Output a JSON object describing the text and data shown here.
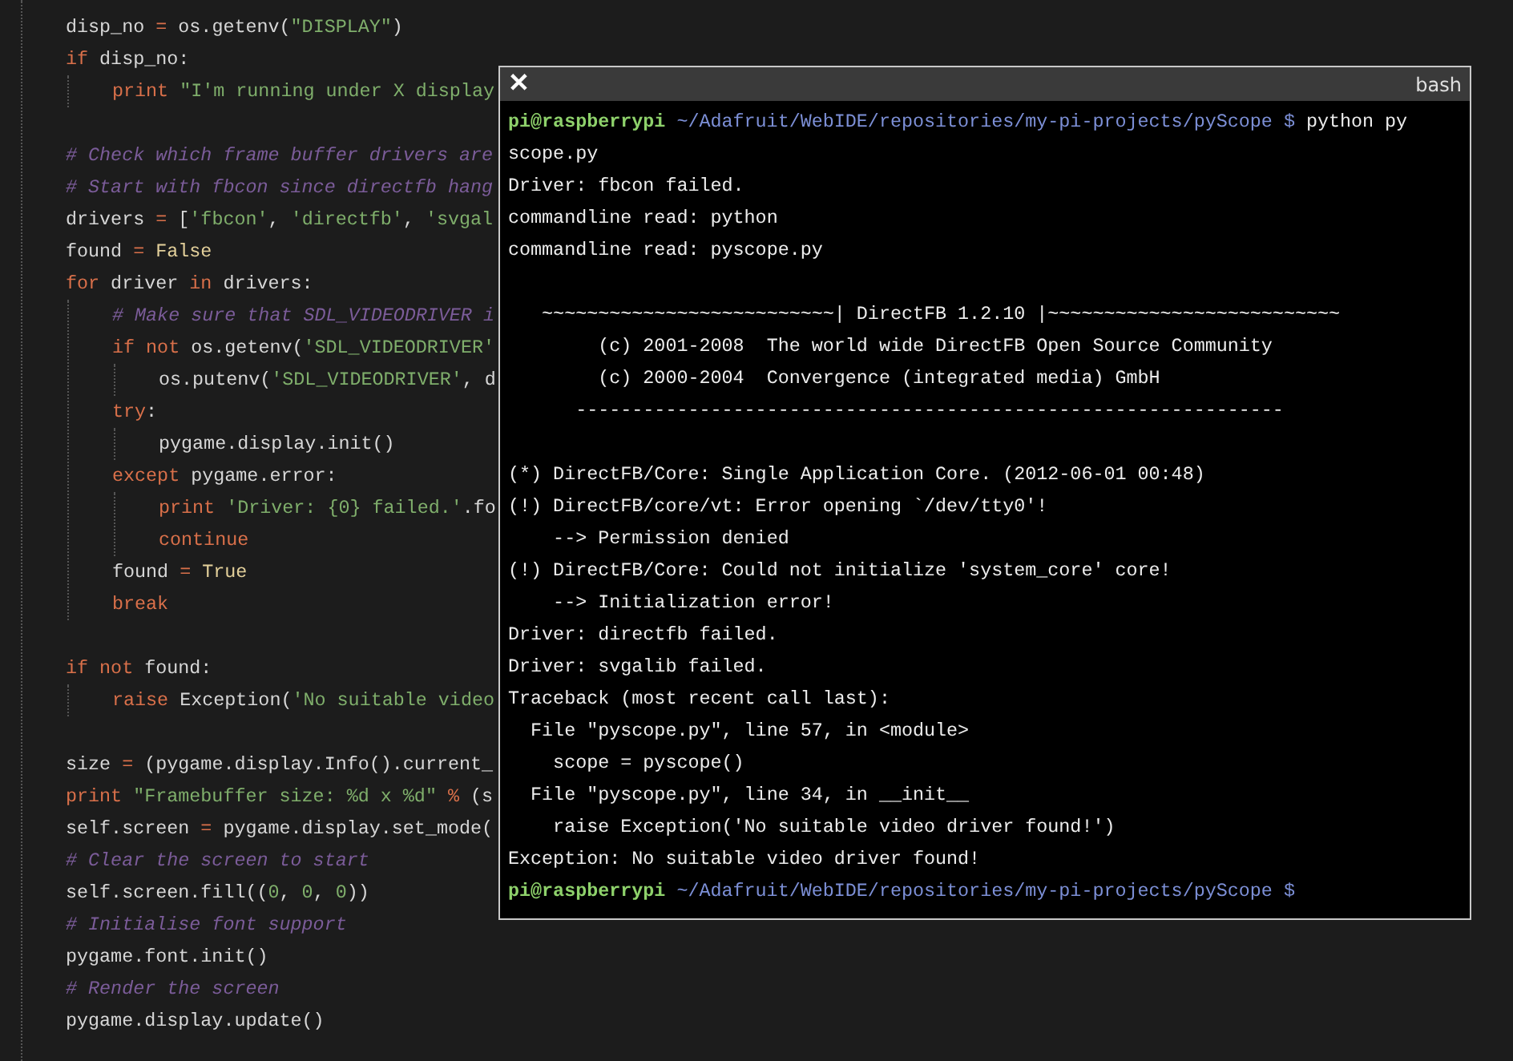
{
  "editor": {
    "lines": [
      {
        "kind": "code",
        "segments": [
          {
            "t": "disp_no",
            "kind": "plain"
          },
          {
            "t": " =",
            "kind": "operator"
          },
          {
            "t": " os.getenv(",
            "kind": "plain"
          },
          {
            "t": "\"DISPLAY\"",
            "kind": "string"
          },
          {
            "t": ")",
            "kind": "plain"
          }
        ]
      },
      {
        "kind": "code",
        "segments": [
          {
            "t": "if",
            "kind": "keyword"
          },
          {
            "t": " disp_no:",
            "kind": "plain"
          }
        ],
        "children": [
          {
            "kind": "code",
            "segments": [
              {
                "t": "print",
                "kind": "keyword"
              },
              {
                "t": " \"I'm running under X display",
                "kind": "string"
              }
            ]
          }
        ]
      },
      {
        "kind": "blank"
      },
      {
        "kind": "code",
        "segments": [
          {
            "t": "# Check which frame buffer drivers are",
            "kind": "comment"
          }
        ]
      },
      {
        "kind": "code",
        "segments": [
          {
            "t": "# Start with fbcon since directfb hang",
            "kind": "comment"
          }
        ]
      },
      {
        "kind": "code",
        "segments": [
          {
            "t": "drivers",
            "kind": "plain"
          },
          {
            "t": " =",
            "kind": "operator"
          },
          {
            "t": " [",
            "kind": "plain"
          },
          {
            "t": "'fbcon'",
            "kind": "string"
          },
          {
            "t": ", ",
            "kind": "plain"
          },
          {
            "t": "'directfb'",
            "kind": "string"
          },
          {
            "t": ", ",
            "kind": "plain"
          },
          {
            "t": "'svgal",
            "kind": "string"
          }
        ]
      },
      {
        "kind": "code",
        "segments": [
          {
            "t": "found",
            "kind": "plain"
          },
          {
            "t": " =",
            "kind": "operator"
          },
          {
            "t": " False",
            "kind": "constant"
          }
        ]
      },
      {
        "kind": "code",
        "segments": [
          {
            "t": "for",
            "kind": "keyword"
          },
          {
            "t": " driver",
            "kind": "plain"
          },
          {
            "t": " in",
            "kind": "keyword"
          },
          {
            "t": " drivers:",
            "kind": "plain"
          }
        ],
        "children": [
          {
            "kind": "code",
            "segments": [
              {
                "t": "# Make sure that SDL_VIDEODRIVER i",
                "kind": "comment"
              }
            ]
          },
          {
            "kind": "code",
            "segments": [
              {
                "t": "if not",
                "kind": "keyword"
              },
              {
                "t": " os.getenv(",
                "kind": "plain"
              },
              {
                "t": "'SDL_VIDEODRIVER'",
                "kind": "string"
              }
            ],
            "children": [
              {
                "kind": "code",
                "segments": [
                  {
                    "t": "os.putenv(",
                    "kind": "plain"
                  },
                  {
                    "t": "'SDL_VIDEODRIVER'",
                    "kind": "string"
                  },
                  {
                    "t": ", d",
                    "kind": "plain"
                  }
                ]
              }
            ]
          },
          {
            "kind": "code",
            "segments": [
              {
                "t": "try",
                "kind": "keyword"
              },
              {
                "t": ":",
                "kind": "plain"
              }
            ],
            "children": [
              {
                "kind": "code",
                "segments": [
                  {
                    "t": "pygame.display.init()",
                    "kind": "plain"
                  }
                ]
              }
            ]
          },
          {
            "kind": "code",
            "segments": [
              {
                "t": "except",
                "kind": "keyword"
              },
              {
                "t": " pygame.error:",
                "kind": "plain"
              }
            ],
            "children": [
              {
                "kind": "code",
                "segments": [
                  {
                    "t": "print",
                    "kind": "keyword"
                  },
                  {
                    "t": " 'Driver: {0} failed.'",
                    "kind": "string"
                  },
                  {
                    "t": ".fo",
                    "kind": "plain"
                  }
                ]
              },
              {
                "kind": "code",
                "segments": [
                  {
                    "t": "continue",
                    "kind": "keyword"
                  }
                ]
              }
            ]
          },
          {
            "kind": "code",
            "segments": [
              {
                "t": "found",
                "kind": "plain"
              },
              {
                "t": " =",
                "kind": "operator"
              },
              {
                "t": " True",
                "kind": "constant"
              }
            ]
          },
          {
            "kind": "code",
            "segments": [
              {
                "t": "break",
                "kind": "keyword"
              }
            ]
          }
        ]
      },
      {
        "kind": "blank"
      },
      {
        "kind": "code",
        "segments": [
          {
            "t": "if not",
            "kind": "keyword"
          },
          {
            "t": " found:",
            "kind": "plain"
          }
        ],
        "children": [
          {
            "kind": "code",
            "segments": [
              {
                "t": "raise",
                "kind": "keyword"
              },
              {
                "t": " Exception(",
                "kind": "plain"
              },
              {
                "t": "'No suitable video",
                "kind": "string"
              }
            ]
          }
        ]
      },
      {
        "kind": "blank"
      },
      {
        "kind": "code",
        "segments": [
          {
            "t": "size",
            "kind": "plain"
          },
          {
            "t": " =",
            "kind": "operator"
          },
          {
            "t": " (pygame.display.Info().current_",
            "kind": "plain"
          }
        ]
      },
      {
        "kind": "code",
        "segments": [
          {
            "t": "print",
            "kind": "keyword"
          },
          {
            "t": " \"Framebuffer size: %d x %d\"",
            "kind": "string"
          },
          {
            "t": " %",
            "kind": "operator"
          },
          {
            "t": " (s",
            "kind": "plain"
          }
        ]
      },
      {
        "kind": "code",
        "segments": [
          {
            "t": "self.screen",
            "kind": "plain"
          },
          {
            "t": " =",
            "kind": "operator"
          },
          {
            "t": " pygame.display.set_mode(",
            "kind": "plain"
          }
        ]
      },
      {
        "kind": "code",
        "segments": [
          {
            "t": "# Clear the screen to start",
            "kind": "comment"
          }
        ]
      },
      {
        "kind": "code",
        "segments": [
          {
            "t": "self.screen.fill((",
            "kind": "plain"
          },
          {
            "t": "0",
            "kind": "number"
          },
          {
            "t": ", ",
            "kind": "plain"
          },
          {
            "t": "0",
            "kind": "number"
          },
          {
            "t": ", ",
            "kind": "plain"
          },
          {
            "t": "0",
            "kind": "number"
          },
          {
            "t": "))",
            "kind": "plain"
          }
        ]
      },
      {
        "kind": "code",
        "segments": [
          {
            "t": "# Initialise font support",
            "kind": "comment"
          }
        ]
      },
      {
        "kind": "code",
        "segments": [
          {
            "t": "pygame.font.init()",
            "kind": "plain"
          }
        ]
      },
      {
        "kind": "code",
        "segments": [
          {
            "t": "# Render the screen",
            "kind": "comment"
          }
        ]
      },
      {
        "kind": "code",
        "segments": [
          {
            "t": "pygame.display.update()",
            "kind": "plain"
          }
        ]
      }
    ]
  },
  "terminal": {
    "close": "✕",
    "title": "bash",
    "lines": [
      {
        "kind": "prompt",
        "user": "pi@raspberrypi",
        "path": "~/Adafruit/WebIDE/repositories/my-pi-projects/pyScope",
        "symbol": "$",
        "command": "python py"
      },
      {
        "kind": "output",
        "text": "scope.py"
      },
      {
        "kind": "output",
        "text": "Driver: fbcon failed."
      },
      {
        "kind": "output",
        "text": "commandline read: python"
      },
      {
        "kind": "output",
        "text": "commandline read: pyscope.py"
      },
      {
        "kind": "blank"
      },
      {
        "kind": "output",
        "text": "   ~~~~~~~~~~~~~~~~~~~~~~~~~~| DirectFB 1.2.10 |~~~~~~~~~~~~~~~~~~~~~~~~~~"
      },
      {
        "kind": "output",
        "text": "        (c) 2001-2008  The world wide DirectFB Open Source Community"
      },
      {
        "kind": "output",
        "text": "        (c) 2000-2004  Convergence (integrated media) GmbH"
      },
      {
        "kind": "output",
        "text": "      ---------------------------------------------------------------"
      },
      {
        "kind": "blank"
      },
      {
        "kind": "output",
        "text": "(*) DirectFB/Core: Single Application Core. (2012-06-01 00:48)"
      },
      {
        "kind": "output",
        "text": "(!) DirectFB/core/vt: Error opening `/dev/tty0'!"
      },
      {
        "kind": "output",
        "text": "    --> Permission denied"
      },
      {
        "kind": "output",
        "text": "(!) DirectFB/Core: Could not initialize 'system_core' core!"
      },
      {
        "kind": "output",
        "text": "    --> Initialization error!"
      },
      {
        "kind": "output",
        "text": "Driver: directfb failed."
      },
      {
        "kind": "output",
        "text": "Driver: svgalib failed."
      },
      {
        "kind": "output",
        "text": "Traceback (most recent call last):"
      },
      {
        "kind": "output",
        "text": "  File \"pyscope.py\", line 57, in <module>"
      },
      {
        "kind": "output",
        "text": "    scope = pyscope()"
      },
      {
        "kind": "output",
        "text": "  File \"pyscope.py\", line 34, in __init__"
      },
      {
        "kind": "output",
        "text": "    raise Exception('No suitable video driver found!')"
      },
      {
        "kind": "output",
        "text": "Exception: No suitable video driver found!"
      },
      {
        "kind": "prompt",
        "user": "pi@raspberrypi",
        "path": "~/Adafruit/WebIDE/repositories/my-pi-projects/pyScope",
        "symbol": "$"
      }
    ]
  }
}
